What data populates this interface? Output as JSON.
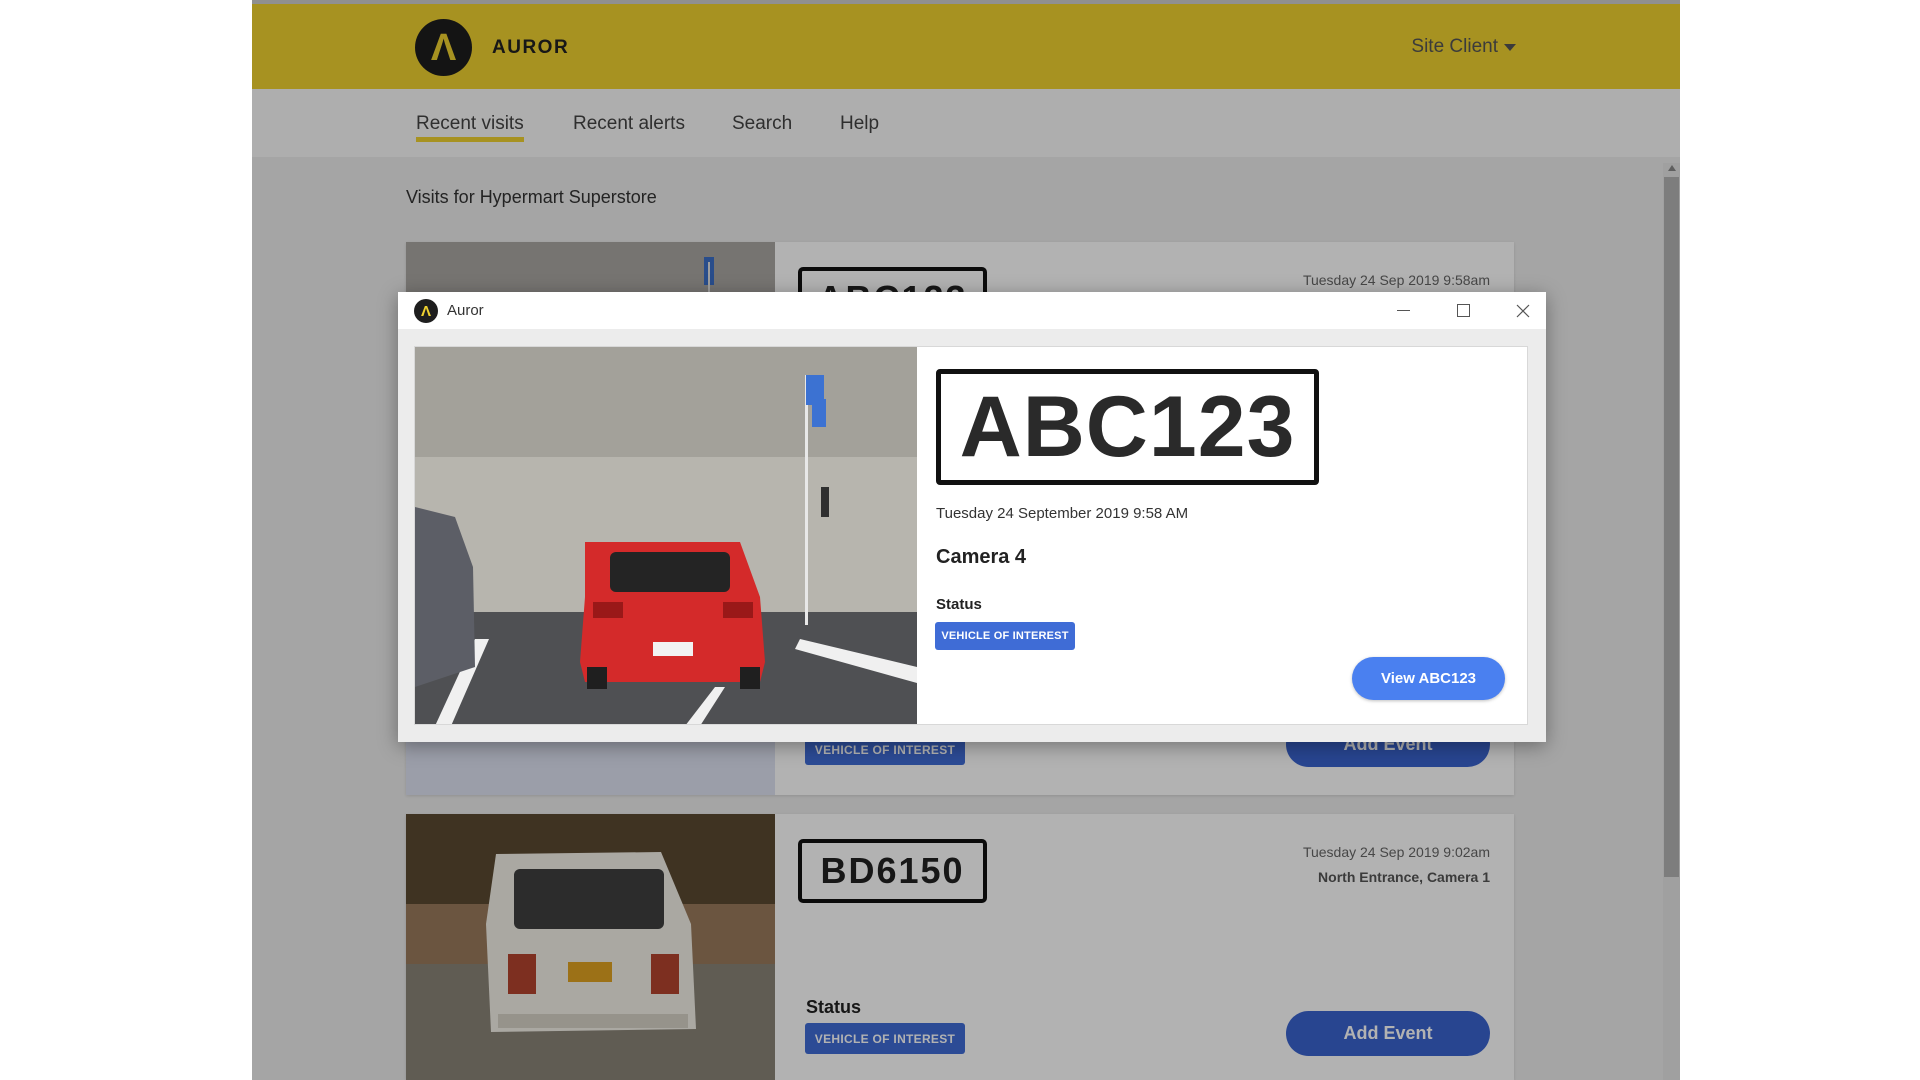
{
  "app": {
    "brand": "AUROR",
    "logo_glyph": "Λ",
    "site_client": "Site Client",
    "nav": [
      "Recent visits",
      "Recent alerts",
      "Search",
      "Help"
    ],
    "visits_title": "Visits for Hypermart Superstore",
    "cards": [
      {
        "plate": "ABC123",
        "date": "Tuesday 24 Sep 2019 9:58am",
        "badge": "VEHICLE OF INTEREST",
        "add_event": "Add Event"
      },
      {
        "plate": "BD6150",
        "date": "Tuesday 24 Sep 2019 9:02am",
        "location": "North Entrance, Camera 1",
        "status_label": "Status",
        "badge": "VEHICLE OF INTEREST",
        "add_event": "Add Event"
      }
    ]
  },
  "modal": {
    "title": "Auror",
    "icon_glyph": "Λ",
    "plate": "ABC123",
    "datetime": "Tuesday 24 September 2019 9:58 AM",
    "camera": "Camera 4",
    "status_label": "Status",
    "badge": "VEHICLE OF INTEREST",
    "view_button": "View ABC123",
    "window_controls": {
      "minimize": "minimize-icon",
      "maximize": "maximize-icon",
      "close": "close-icon"
    }
  },
  "colors": {
    "header_yellow": "#f0d230",
    "badge_blue": "#3f6cd6",
    "button_blue": "#3a63cf",
    "view_button_blue": "#4a80f0",
    "car_red": "#d42a2a"
  }
}
